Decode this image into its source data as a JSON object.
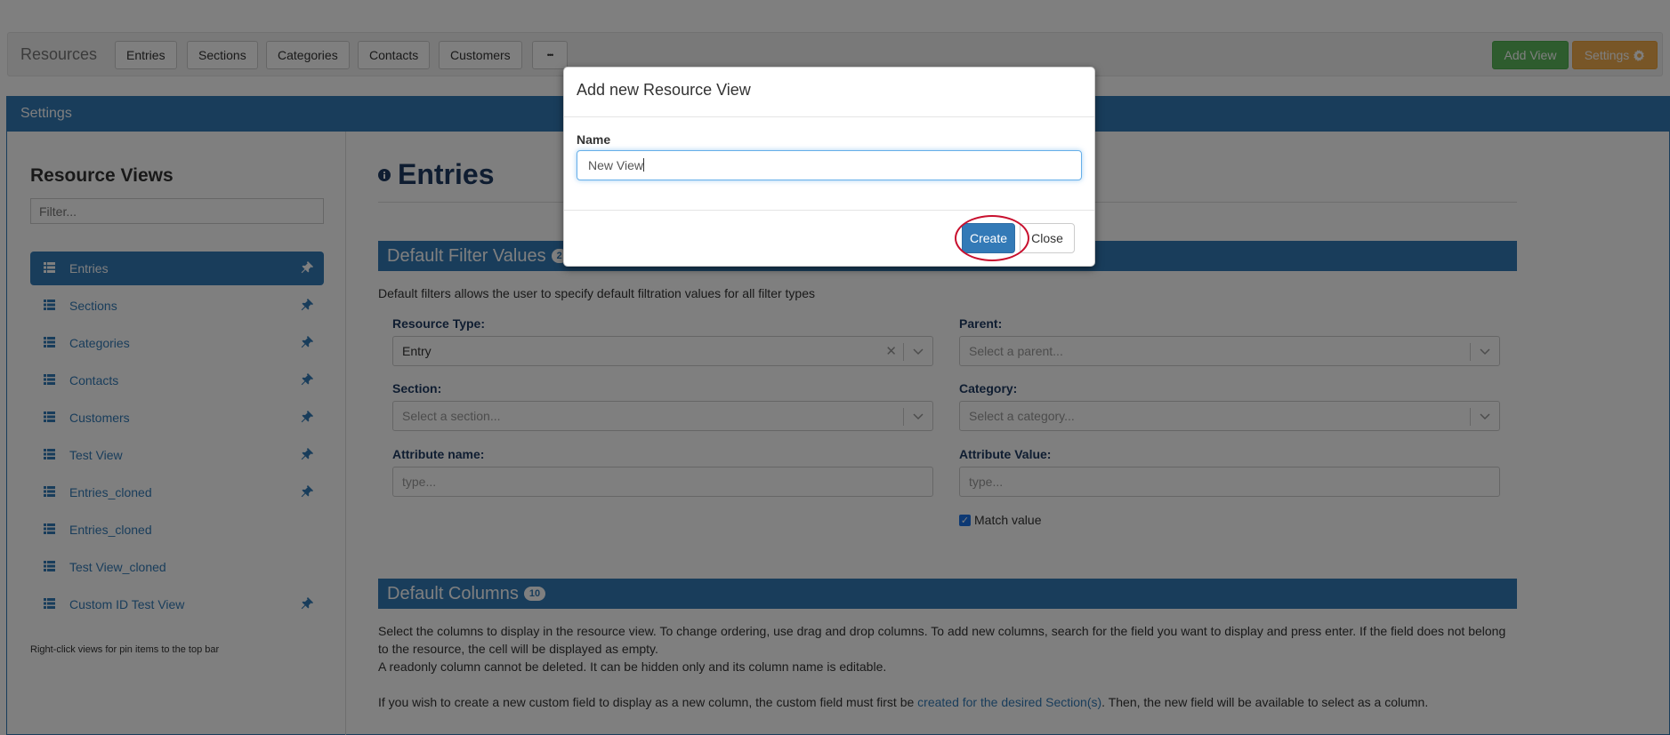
{
  "topbar": {
    "brand": "Resources",
    "nav": [
      "Entries",
      "Sections",
      "Categories",
      "Contacts",
      "Customers"
    ],
    "more_label": "•••",
    "add_view_label": "Add View",
    "settings_label": "Settings"
  },
  "panel": {
    "title": "Settings"
  },
  "sidebar": {
    "title": "Resource Views",
    "filter_placeholder": "Filter...",
    "items": [
      {
        "label": "Entries",
        "pinned": true,
        "active": true
      },
      {
        "label": "Sections",
        "pinned": true
      },
      {
        "label": "Categories",
        "pinned": true
      },
      {
        "label": "Contacts",
        "pinned": true
      },
      {
        "label": "Customers",
        "pinned": true
      },
      {
        "label": "Test View",
        "pinned": true
      },
      {
        "label": "Entries_cloned",
        "pinned": true
      },
      {
        "label": "Entries_cloned",
        "pinned": false
      },
      {
        "label": "Test View_cloned",
        "pinned": false
      },
      {
        "label": "Custom ID Test View",
        "pinned": true
      }
    ],
    "hint": "Right-click views for pin items to the top bar"
  },
  "main": {
    "heading": "Entries",
    "filters": {
      "title": "Default Filter Values",
      "count": "2",
      "description": "Default filters allows the user to specify default filtration values for all filter types",
      "resource_type_label": "Resource Type:",
      "resource_type_value": "Entry",
      "parent_label": "Parent:",
      "parent_placeholder": "Select a parent...",
      "section_label": "Section:",
      "section_placeholder": "Select a section...",
      "category_label": "Category:",
      "category_placeholder": "Select a category...",
      "attr_name_label": "Attribute name:",
      "attr_name_placeholder": "type...",
      "attr_value_label": "Attribute Value:",
      "attr_value_placeholder": "type...",
      "match_label": "Match value",
      "match_checked": true
    },
    "columns": {
      "title": "Default Columns",
      "count": "10",
      "desc1": "Select the columns to display in the resource view. To change ordering, use drag and drop columns. To add new columns, search for the field you want to display and press enter. If the field does not belong",
      "desc2": "to the resource, the cell will be displayed as empty.",
      "desc3": "A readonly column cannot be deleted. It can be hidden only and its column name is editable.",
      "desc4_pre": "If you wish to create a new custom field to display as a new column, the custom field must first be ",
      "desc4_link": "created for the desired Section(s)",
      "desc4_post": ". Then, the new field will be available to select as a column."
    }
  },
  "modal": {
    "title": "Add new Resource View",
    "name_label": "Name",
    "name_value": "New View",
    "create_label": "Create",
    "close_label": "Close"
  },
  "colors": {
    "primary": "#337ab7",
    "success": "#5cb85c",
    "warning": "#f0ad4e",
    "highlight_ring": "#c8102e"
  }
}
